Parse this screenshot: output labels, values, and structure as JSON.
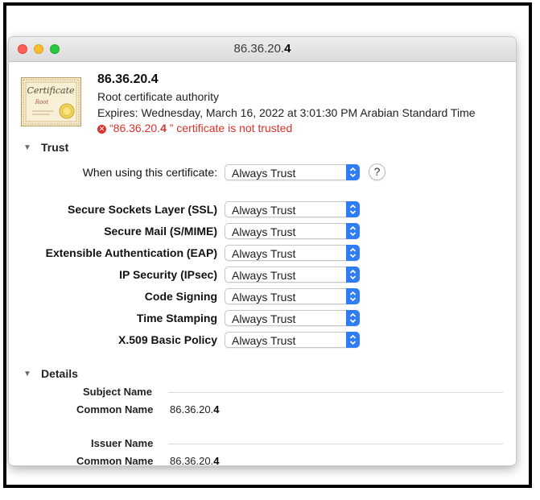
{
  "window": {
    "title_main": "86.36.20.",
    "title_bold": "4"
  },
  "colors": {
    "error": "#e0302b",
    "accent": "#2f7df6"
  },
  "certificate": {
    "icon": "certificate-icon",
    "badge_text": "Certificate",
    "badge_subtext": "Root",
    "name_main": "86.36.20.",
    "name_bold": "4",
    "kind": "Root certificate authority",
    "expires": "Expires: Wednesday, March 16, 2022 at 3:01:30 PM Arabian Standard Time",
    "error_icon": "x-circle-icon",
    "error_prefix": "“86.36.20.",
    "error_bold": "4",
    "error_suffix": " ” certificate is not trusted"
  },
  "trust": {
    "section_label": "Trust",
    "when_using_label": "When using this certificate:",
    "when_using_value": "Always Trust",
    "help_label": "?",
    "rows": [
      {
        "label": "Secure Sockets Layer (SSL)",
        "value": "Always Trust"
      },
      {
        "label": "Secure Mail (S/MIME)",
        "value": "Always Trust"
      },
      {
        "label": "Extensible Authentication (EAP)",
        "value": "Always Trust"
      },
      {
        "label": "IP Security (IPsec)",
        "value": "Always Trust"
      },
      {
        "label": "Code Signing",
        "value": "Always Trust"
      },
      {
        "label": "Time Stamping",
        "value": "Always Trust"
      },
      {
        "label": "X.509 Basic Policy",
        "value": "Always Trust"
      }
    ]
  },
  "details": {
    "section_label": "Details",
    "subject_heading": "Subject Name",
    "subject_cn_label": "Common Name",
    "subject_cn_main": "86.36.20.",
    "subject_cn_bold": "4",
    "issuer_heading": "Issuer Name",
    "issuer_cn_label": "Common Name",
    "issuer_cn_main": "86.36.20.",
    "issuer_cn_bold": "4"
  }
}
